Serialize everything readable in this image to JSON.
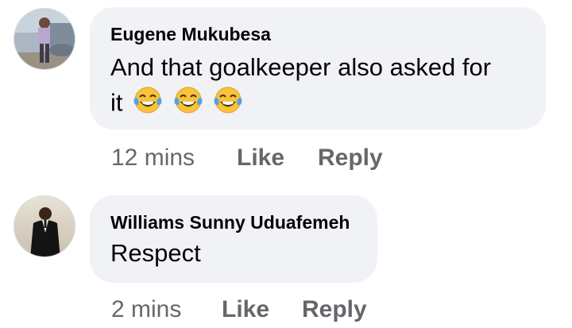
{
  "comments": [
    {
      "author": "Eugene Mukubesa",
      "text_line1": "And that goalkeeper also asked for",
      "text_line2": "it",
      "emojis": [
        "tears-of-joy-emoji",
        "tears-of-joy-emoji",
        "tears-of-joy-emoji"
      ],
      "time": "12 mins",
      "like_label": "Like",
      "reply_label": "Reply"
    },
    {
      "author": "Williams Sunny Uduafemeh",
      "text": "Respect",
      "time": "2 mins",
      "like_label": "Like",
      "reply_label": "Reply"
    }
  ],
  "colors": {
    "bubble": "#f0f2f5",
    "text": "#050505",
    "meta": "#65676b"
  }
}
